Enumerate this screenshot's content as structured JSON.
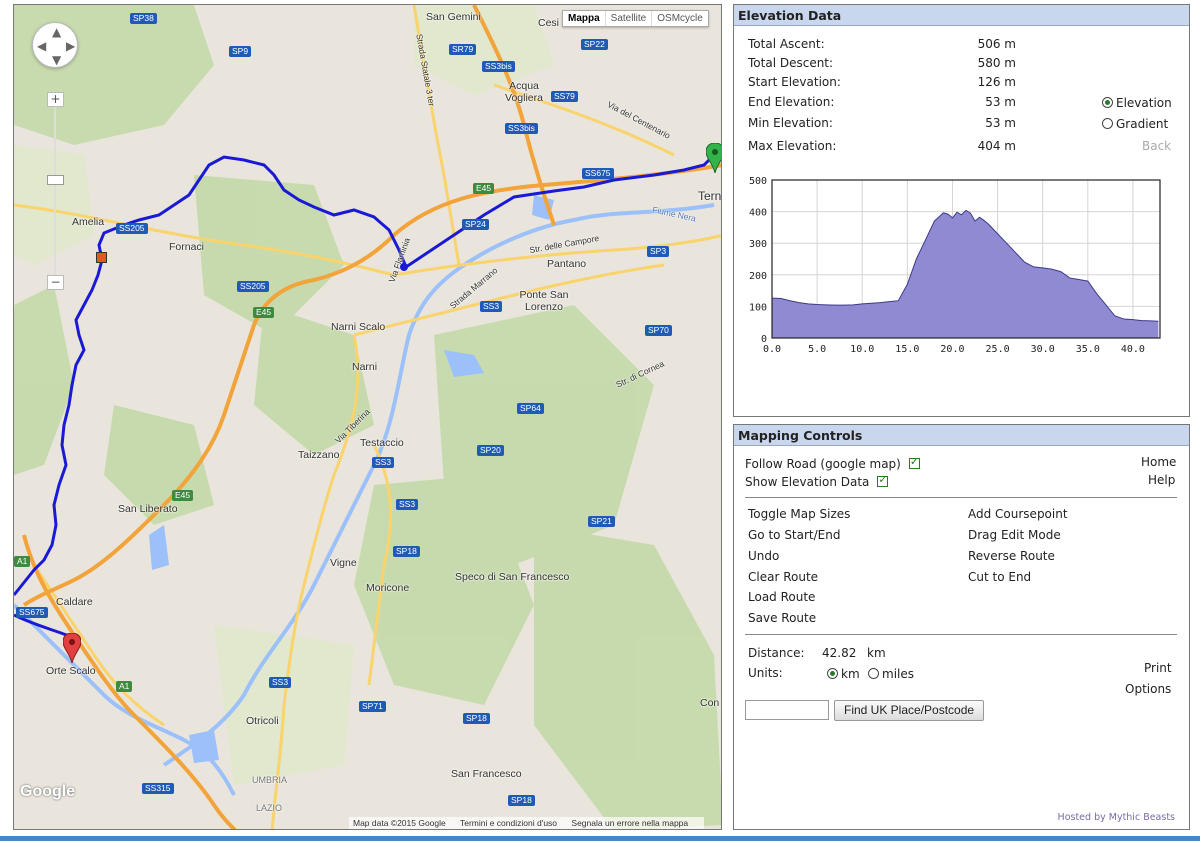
{
  "map": {
    "map_types": [
      "Mappa",
      "Satellite",
      "OSMcycle"
    ],
    "zoom_in": "+",
    "zoom_out": "−",
    "places": [
      {
        "name": "San Gemini"
      },
      {
        "name": "Cesi"
      },
      {
        "name": "Acqua Vogliera"
      },
      {
        "name": "Amelia"
      },
      {
        "name": "Fornaci"
      },
      {
        "name": "Narni Scalo"
      },
      {
        "name": "Narni"
      },
      {
        "name": "Pantano"
      },
      {
        "name": "Ponte San Lorenzo"
      },
      {
        "name": "Testaccio"
      },
      {
        "name": "Taizzano"
      },
      {
        "name": "San Liberato"
      },
      {
        "name": "Vigne"
      },
      {
        "name": "Moricone"
      },
      {
        "name": "Speco di San Francesco"
      },
      {
        "name": "Caldare"
      },
      {
        "name": "Orte Scalo"
      },
      {
        "name": "Otricoli"
      },
      {
        "name": "San Francesco"
      },
      {
        "name": "UMBRIA"
      },
      {
        "name": "LAZIO"
      },
      {
        "name": "Terni"
      },
      {
        "name": "Con"
      },
      {
        "name": "Via del Centenario"
      },
      {
        "name": "Fiume Nera"
      },
      {
        "name": "Str. delle Campore"
      },
      {
        "name": "Strada Marrano"
      },
      {
        "name": "Str. di Cornea"
      },
      {
        "name": "Via Tiberina"
      },
      {
        "name": "Strada Statale 3 ter"
      },
      {
        "name": "Via Flaminia"
      }
    ],
    "road_shields": [
      "SP38",
      "SP9",
      "SR79",
      "SP22",
      "SS3bis",
      "SS79",
      "SS3bis",
      "SS675",
      "E45",
      "SP24",
      "SS205",
      "SS205",
      "SP3",
      "SS3",
      "E45",
      "SP70",
      "SP64",
      "SP20",
      "SS3",
      "E45",
      "SS3",
      "SP21",
      "SP18",
      "SS675",
      "A1",
      "A1",
      "SS3",
      "SP71",
      "SP18",
      "SS315",
      "SP18"
    ],
    "google_logo": "Google",
    "attribution": [
      "Map data ©2015 Google",
      "Termini e condizioni d'uso",
      "Segnala un errore nella mappa"
    ],
    "colors": {
      "route": "#1a1ad6",
      "motorway": "#f2a33a",
      "primary": "#f9d36b",
      "water": "#9cc0f9",
      "forest": "#b9d49a"
    }
  },
  "elevation": {
    "title": "Elevation Data",
    "stats": [
      {
        "label": "Total Ascent:",
        "value": "506 m"
      },
      {
        "label": "Total Descent:",
        "value": "580 m"
      },
      {
        "label": "Start Elevation:",
        "value": "126 m"
      },
      {
        "label": "End Elevation:",
        "value": "53 m"
      },
      {
        "label": "Min Elevation:",
        "value": "53 m"
      },
      {
        "label": "Max Elevation:",
        "value": "404 m"
      }
    ],
    "mode_elevation": "Elevation",
    "mode_gradient": "Gradient",
    "back": "Back"
  },
  "chart_data": {
    "type": "area",
    "x": [
      0,
      1,
      2,
      3,
      4,
      5,
      6,
      7,
      8,
      9,
      10,
      11,
      12,
      13,
      14,
      15,
      16,
      17,
      18,
      19,
      19.5,
      20,
      20.5,
      21,
      21.5,
      22,
      22.5,
      23,
      23.5,
      24,
      25,
      26,
      27,
      28,
      29,
      30,
      31,
      32,
      33,
      34,
      35,
      36,
      37,
      38,
      39,
      40,
      41,
      42,
      42.82
    ],
    "values": [
      126,
      125,
      118,
      112,
      108,
      106,
      105,
      104,
      104,
      105,
      108,
      110,
      112,
      115,
      118,
      170,
      250,
      310,
      370,
      396,
      392,
      380,
      398,
      390,
      404,
      395,
      370,
      382,
      372,
      360,
      330,
      300,
      270,
      240,
      225,
      222,
      218,
      210,
      190,
      185,
      180,
      140,
      105,
      70,
      60,
      58,
      55,
      54,
      53
    ],
    "xlim": [
      0,
      43
    ],
    "ylim": [
      0,
      500
    ],
    "x_ticks": [
      "0.0",
      "5.0",
      "10.0",
      "15.0",
      "20.0",
      "25.0",
      "30.0",
      "35.0",
      "40.0"
    ],
    "y_ticks": [
      "0",
      "100",
      "200",
      "300",
      "400",
      "500"
    ],
    "title": "",
    "xlabel": "",
    "ylabel": "",
    "grid": true,
    "fill_color": "#8f8ad2",
    "line_color": "#3b3a8a"
  },
  "controls": {
    "title": "Mapping Controls",
    "follow_road": "Follow Road (google map)",
    "show_elevation": "Show Elevation Data",
    "home": "Home",
    "help": "Help",
    "left_actions": [
      "Toggle Map Sizes",
      "Go to Start/End",
      "Undo",
      "Clear Route",
      "Load Route",
      "Save Route"
    ],
    "right_actions": [
      "Add Coursepoint",
      "Drag Edit Mode",
      "Reverse Route",
      "Cut to End"
    ],
    "distance_label": "Distance:",
    "distance_value": "42.82",
    "distance_unit": "km",
    "units_label": "Units:",
    "unit_km": "km",
    "unit_miles": "miles",
    "print": "Print",
    "options": "Options",
    "find_button": "Find UK Place/Postcode",
    "find_input_value": "",
    "hosted_by": "Hosted by Mythic Beasts"
  }
}
